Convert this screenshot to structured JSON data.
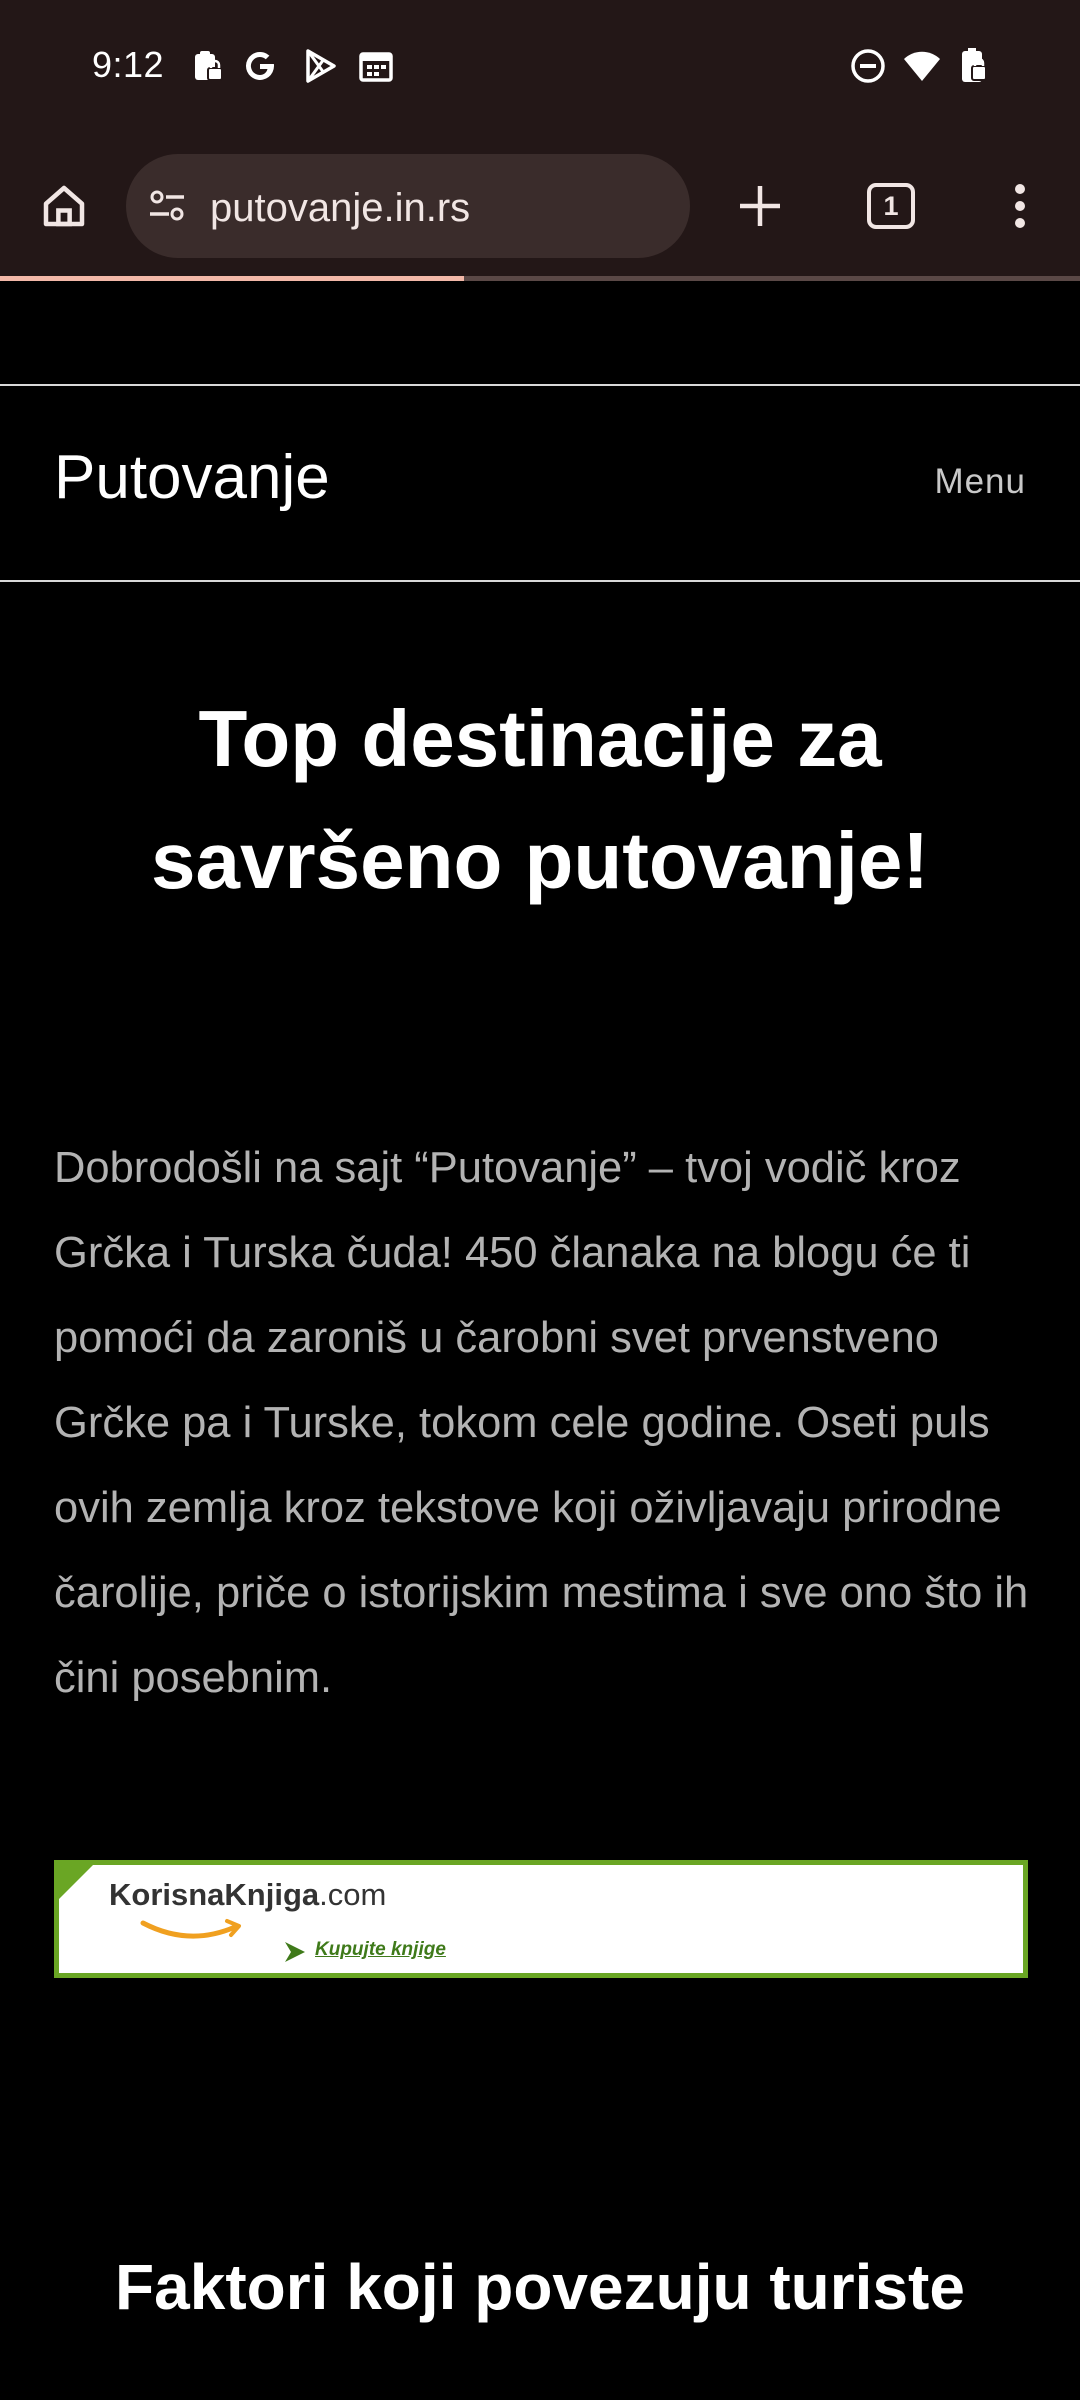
{
  "status_bar": {
    "time": "9:12",
    "left_icons": [
      "clipboard-lock-icon",
      "google-icon",
      "play-store-icon",
      "calendar-icon"
    ],
    "right_icons": [
      "do-not-disturb-icon",
      "wifi-icon",
      "battery-icon"
    ]
  },
  "browser": {
    "url": "putovanje.in.rs",
    "tab_count": "1",
    "load_progress": 0.43
  },
  "site": {
    "title": "Putovanje",
    "menu_label": "Menu"
  },
  "hero": {
    "title": "Top destinacije za savršeno putovanje!"
  },
  "intro": {
    "text": "Dobrodošli na sajt “Putovanje” – tvoj vodič kroz Grčka i Turska čuda! 450 članaka na blogu će ti pomoći da zaroniš u čarobni svet prvenstveno Grčke pa i Turske, tokom cele godine. Oseti puls ovih zemlja kroz tekstove koji oživljavaju prirodne čarolije, priče o istorijskim mestima i sve ono što ih čini posebnim."
  },
  "banner": {
    "brand_bold": "KorisnaKnjiga",
    "brand_suffix": ".com",
    "link_text": "Kupujte knjige",
    "accent_color": "#6aa624",
    "smile_color": "#f0a020"
  },
  "section": {
    "title": "Faktori koji povezuju turiste"
  },
  "colors": {
    "chrome_bg": "#231717",
    "url_bar_bg": "#3a2c2b",
    "progress": "#f2b8a8",
    "page_bg": "#000000"
  }
}
